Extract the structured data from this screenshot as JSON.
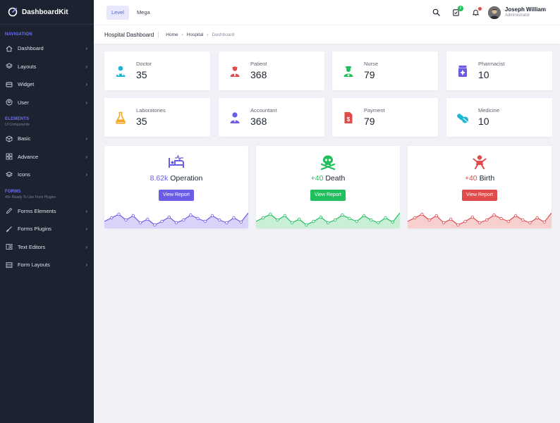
{
  "brand": {
    "name": "DashboardKit"
  },
  "sidebar": {
    "sections": [
      {
        "caption": "NAVIGATION",
        "sub": "",
        "items": [
          {
            "label": "Dashboard",
            "icon": "home-icon"
          },
          {
            "label": "Layouts",
            "icon": "layers-icon"
          },
          {
            "label": "Widget",
            "icon": "widget-icon"
          },
          {
            "label": "User",
            "icon": "user-icon"
          }
        ]
      },
      {
        "caption": "ELEMENTS",
        "sub": "UI Components",
        "items": [
          {
            "label": "Basic",
            "icon": "box-icon"
          },
          {
            "label": "Advance",
            "icon": "grid-icon"
          },
          {
            "label": "Icons",
            "icon": "layers-icon"
          }
        ]
      },
      {
        "caption": "FORMS",
        "sub": "40+ Ready To Use From Plugins",
        "items": [
          {
            "label": "Forms Elements",
            "icon": "pen-icon"
          },
          {
            "label": "Forms Plugins",
            "icon": "brush-icon"
          },
          {
            "label": "Text Editors",
            "icon": "editor-icon"
          },
          {
            "label": "Form Layouts",
            "icon": "layout-icon"
          }
        ]
      }
    ]
  },
  "header": {
    "tabs": [
      {
        "label": "Level",
        "active": true
      },
      {
        "label": "Mega",
        "active": false
      }
    ],
    "notifications": {
      "cart_count": "3"
    },
    "user": {
      "name": "Joseph William",
      "role": "Administrator"
    }
  },
  "breadcrumb": {
    "title": "Hospital Dashboard",
    "items": [
      "Home",
      "Hospital",
      "Dashboard"
    ]
  },
  "stats": [
    {
      "label": "Doctor",
      "value": "35",
      "icon": "doctor-icon",
      "color": "#1fb6d4"
    },
    {
      "label": "Patient",
      "value": "368",
      "icon": "patient-icon",
      "color": "#e04b4b"
    },
    {
      "label": "Nurse",
      "value": "79",
      "icon": "nurse-icon",
      "color": "#1fbf5e"
    },
    {
      "label": "Pharmacist",
      "value": "10",
      "icon": "pharmacist-icon",
      "color": "#6b5ce7"
    },
    {
      "label": "Laboratories",
      "value": "35",
      "icon": "flask-icon",
      "color": "#f5a623"
    },
    {
      "label": "Accountant",
      "value": "368",
      "icon": "accountant-icon",
      "color": "#6b5ce7"
    },
    {
      "label": "Payment",
      "value": "79",
      "icon": "invoice-icon",
      "color": "#e04b4b"
    },
    {
      "label": "Medicine",
      "value": "10",
      "icon": "pills-icon",
      "color": "#1fb6d4"
    }
  ],
  "reports": [
    {
      "value": "8.62k",
      "label": "Operation",
      "button": "View Report",
      "icon": "bed-icon",
      "color": "#6b5ce7",
      "fill": "#d9d3fa"
    },
    {
      "value": "+40",
      "label": "Death",
      "button": "View Report",
      "icon": "skull-icon",
      "color": "#1fbf5e",
      "fill": "#c9f0d7"
    },
    {
      "value": "+40",
      "label": "Birth",
      "button": "View Report",
      "icon": "baby-icon",
      "color": "#e04b4b",
      "fill": "#f8cfcf"
    }
  ]
}
